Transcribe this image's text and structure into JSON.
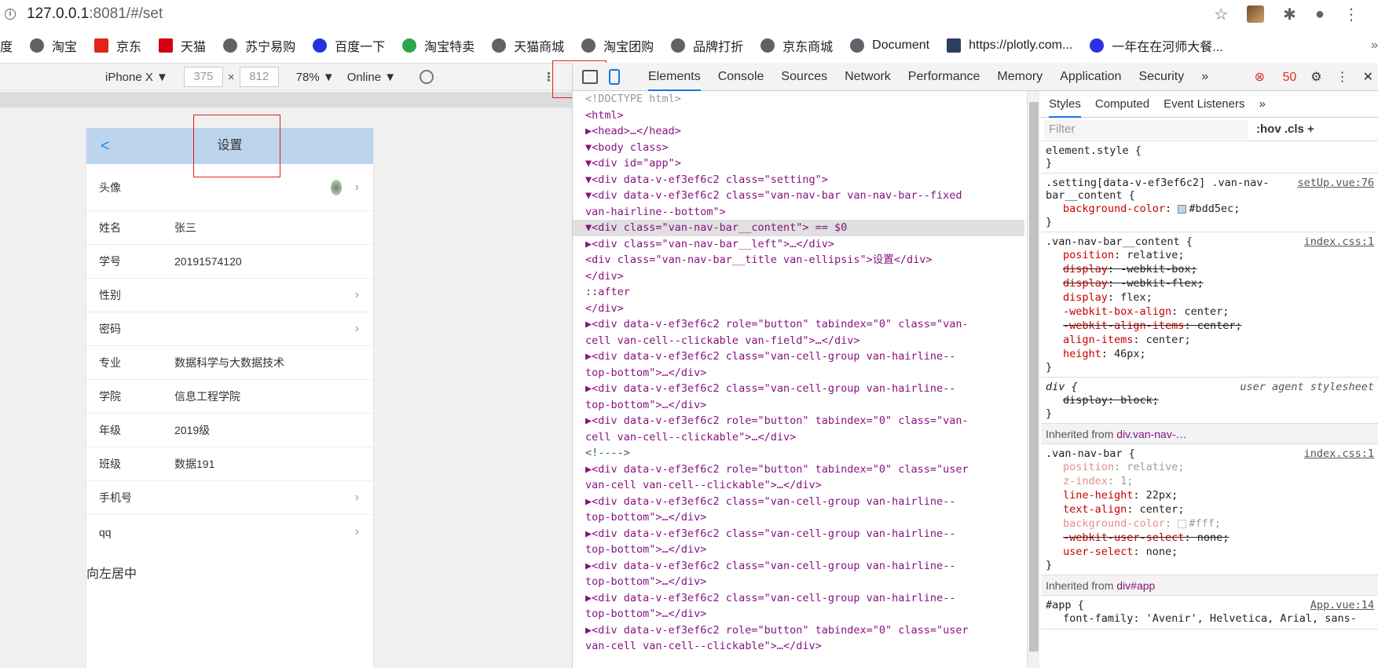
{
  "address_bar": {
    "host": "127.0.0.1",
    "rest": ":8081/#/set"
  },
  "bookmarks": [
    "度",
    "淘宝",
    "京东",
    "天猫",
    "苏宁易购",
    "百度一下",
    "淘宝特卖",
    "天猫商城",
    "淘宝团购",
    "品牌打折",
    "京东商城",
    "Document",
    "https://plotly.com...",
    "一年在在河师大餐..."
  ],
  "device_toolbar": {
    "device": "iPhone X ▼",
    "width": "375",
    "x": "×",
    "height": "812",
    "zoom": "78% ▼",
    "network": "Online ▼"
  },
  "phone": {
    "title": "设置",
    "back": "<",
    "rows": [
      {
        "label": "头像",
        "value": ""
      },
      {
        "label": "姓名",
        "value": "张三"
      },
      {
        "label": "学号",
        "value": "20191574120"
      },
      {
        "label": "性别",
        "value": ""
      },
      {
        "label": "密码",
        "value": ""
      },
      {
        "label": "专业",
        "value": "数据科学与大数据技术"
      },
      {
        "label": "学院",
        "value": "信息工程学院"
      },
      {
        "label": "年级",
        "value": "2019级"
      },
      {
        "label": "班级",
        "value": "数据191"
      },
      {
        "label": "手机号",
        "value": ""
      },
      {
        "label": "qq",
        "value": ""
      }
    ],
    "footnote": "向左居中"
  },
  "devtools": {
    "tabs": [
      "Elements",
      "Console",
      "Sources",
      "Network",
      "Performance",
      "Memory",
      "Application",
      "Security",
      "»"
    ],
    "error_count": "50",
    "styles_tabs": [
      "Styles",
      "Computed",
      "Event Listeners",
      "»"
    ],
    "filter_placeholder": "Filter",
    "filter_ops": ":hov  .cls  +",
    "dom_lines": [
      "<!DOCTYPE html>",
      "<html>",
      "▶<head>…</head>",
      "▼<body class>",
      "  ▼<div id=\"app\">",
      "    ▼<div data-v-ef3ef6c2 class=\"setting\">",
      "      ▼<div data-v-ef3ef6c2 class=\"van-nav-bar van-nav-bar--fixed",
      "      van-hairline--bottom\">",
      "        ▼<div class=\"van-nav-bar__content\"> == $0",
      "          ▶<div class=\"van-nav-bar__left\">…</div>",
      "           <div class=\"van-nav-bar__title van-ellipsis\">设置</div>",
      "          </div>",
      "          ::after",
      "        </div>",
      "      ▶<div data-v-ef3ef6c2 role=\"button\" tabindex=\"0\" class=\"van-",
      "      cell van-cell--clickable van-field\">…</div>",
      "      ▶<div data-v-ef3ef6c2 class=\"van-cell-group van-hairline--",
      "      top-bottom\">…</div>",
      "      ▶<div data-v-ef3ef6c2 class=\"van-cell-group van-hairline--",
      "      top-bottom\">…</div>",
      "      ▶<div data-v-ef3ef6c2 role=\"button\" tabindex=\"0\" class=\"van-",
      "      cell van-cell--clickable\">…</div>",
      "        <!---->",
      "      ▶<div data-v-ef3ef6c2 role=\"button\" tabindex=\"0\" class=\"user",
      "      van-cell van-cell--clickable\">…</div>",
      "      ▶<div data-v-ef3ef6c2 class=\"van-cell-group van-hairline--",
      "      top-bottom\">…</div>",
      "      ▶<div data-v-ef3ef6c2 class=\"van-cell-group van-hairline--",
      "      top-bottom\">…</div>",
      "      ▶<div data-v-ef3ef6c2 class=\"van-cell-group van-hairline--",
      "      top-bottom\">…</div>",
      "      ▶<div data-v-ef3ef6c2 class=\"van-cell-group van-hairline--",
      "      top-bottom\">…</div>",
      "      ▶<div data-v-ef3ef6c2 role=\"button\" tabindex=\"0\" class=\"user",
      "      van-cell van-cell--clickable\">…</div>"
    ],
    "styles": {
      "element_style": "element.style {",
      "rule1_selector": ".setting[data-v-ef3ef6c2] .van-nav-bar__content {",
      "rule1_src": "setUp.vue:76",
      "rule1_prop": "background-color",
      "rule1_val": "#bdd5ec;",
      "rule2_selector": ".van-nav-bar__content {",
      "rule2_src": "index.css:1",
      "rule2_props": [
        [
          "position",
          "relative;",
          "normal"
        ],
        [
          "display",
          "-webkit-box;",
          "strike"
        ],
        [
          "display",
          "-webkit-flex;",
          "strike"
        ],
        [
          "display",
          "flex;",
          "normal"
        ],
        [
          "-webkit-box-align",
          "center;",
          "normal"
        ],
        [
          "-webkit-align-items",
          "center;",
          "strike"
        ],
        [
          "align-items",
          "center;",
          "normal"
        ],
        [
          "height",
          "46px;",
          "normal"
        ]
      ],
      "rule3_selector": "div {",
      "rule3_src": "user agent stylesheet",
      "rule3_prop": "display: block;",
      "inherited1": "Inherited from",
      "inherited1_target": "div.van-nav-…",
      "rule4_selector": ".van-nav-bar {",
      "rule4_src": "index.css:1",
      "rule4_props": [
        [
          "position",
          "relative;",
          "faint"
        ],
        [
          "z-index",
          "1;",
          "faint"
        ],
        [
          "line-height",
          "22px;",
          "normal"
        ],
        [
          "text-align",
          "center;",
          "normal"
        ],
        [
          "background-color",
          "#fff;",
          "faint"
        ],
        [
          "-webkit-user-select",
          "none;",
          "strike"
        ],
        [
          "user-select",
          "none;",
          "normal"
        ]
      ],
      "inherited2": "Inherited from",
      "inherited2_target": "div#app",
      "rule5_selector": "#app {",
      "rule5_src": "App.vue:14",
      "rule5_prop": "font-family: 'Avenir', Helvetica, Arial, sans-"
    }
  },
  "colors": {
    "navbar": "#bdd5ec",
    "accent": "#1a73e8",
    "redbox": "#e0201c"
  }
}
